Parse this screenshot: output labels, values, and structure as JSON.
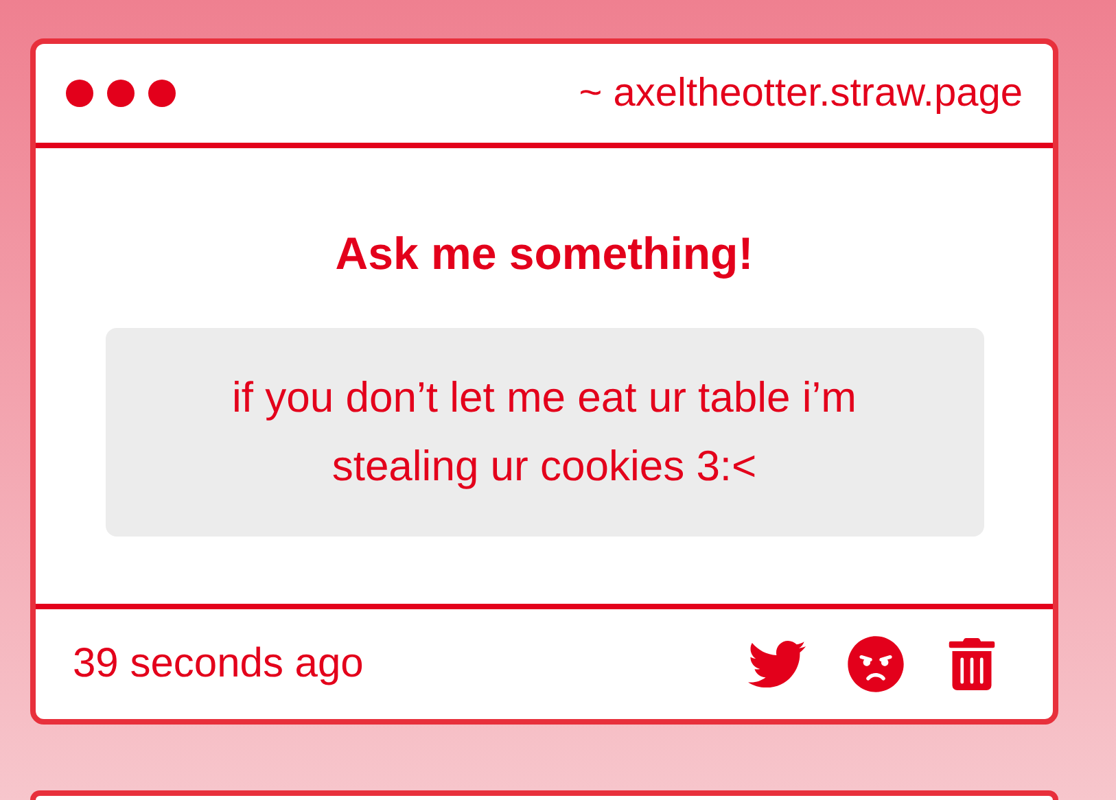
{
  "window": {
    "address": "~ axeltheotter.straw.page"
  },
  "card": {
    "title": "Ask me something!",
    "question": "if you don’t let me eat ur table i’m stealing ur cookies 3:<",
    "time": "39 seconds ago"
  }
}
